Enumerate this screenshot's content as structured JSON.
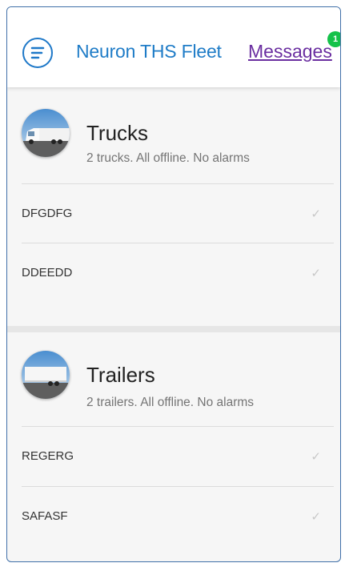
{
  "header": {
    "menu_icon": "menu-lines-icon",
    "app_title": "Neuron THS Fleet",
    "messages_label": "Messages",
    "messages_badge": "1",
    "colors": {
      "primary": "#1f7cc7",
      "link": "#6a2ea0",
      "badge": "#15c24a"
    }
  },
  "trucks": {
    "icon": "truck-icon",
    "title": "Trucks",
    "subtitle": "2 trucks. All offline. No alarms",
    "items": [
      {
        "label": "DFGDFG",
        "status_icon": "check-icon"
      },
      {
        "label": "DDEEDD",
        "status_icon": "check-icon"
      }
    ]
  },
  "trailers": {
    "icon": "trailer-icon",
    "title": "Trailers",
    "subtitle": "2 trailers. All offline. No alarms",
    "items": [
      {
        "label": "REGERG",
        "status_icon": "check-icon"
      },
      {
        "label": "SAFASF",
        "status_icon": "check-icon"
      }
    ]
  }
}
